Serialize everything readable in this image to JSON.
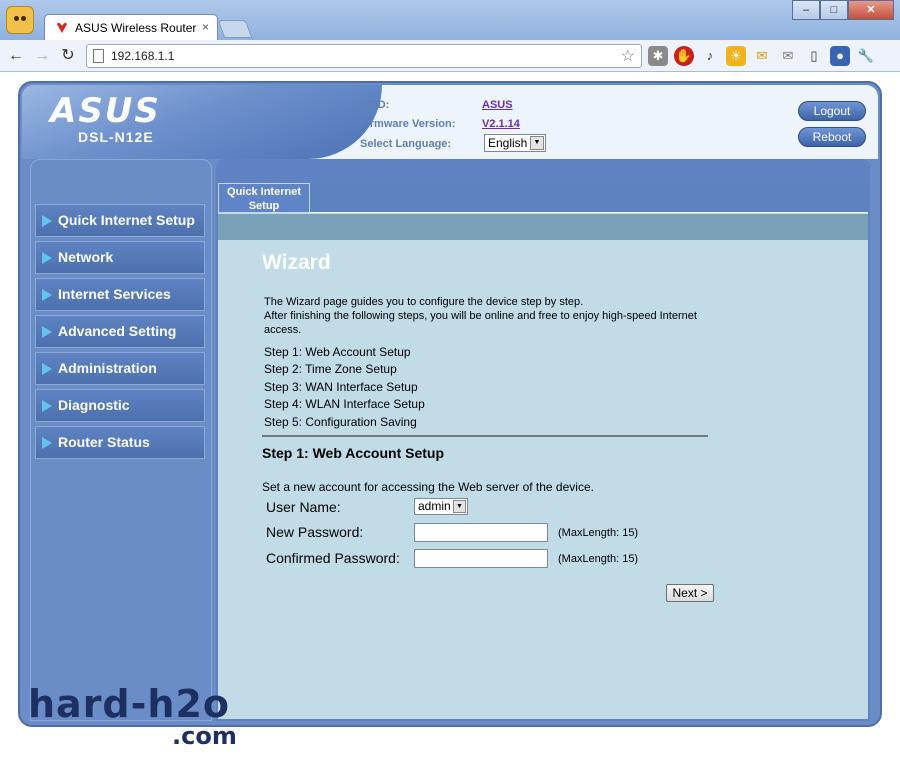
{
  "browser": {
    "tab_title": "ASUS Wireless Router",
    "tab_close": "×",
    "url": "192.168.1.1",
    "window_buttons": {
      "minimize": "–",
      "maximize": "□",
      "close": "✕"
    }
  },
  "router": {
    "brand": "ASUS",
    "model": "DSL-N12E",
    "ssid_label": "SSID:",
    "ssid_value": "ASUS",
    "firmware_label": "Firmware Version:",
    "firmware_value": "V2.1.14",
    "language_label": "Select Language:",
    "language_value": "English",
    "logout_label": "Logout",
    "reboot_label": "Reboot"
  },
  "menu": {
    "items": [
      "Quick Internet Setup",
      "Network",
      "Internet Services",
      "Advanced Setting",
      "Administration",
      "Diagnostic",
      "Router Status"
    ]
  },
  "content": {
    "tab_label": "Quick Internet Setup",
    "title": "Wizard",
    "intro_line1": "The Wizard page guides you to configure the device step by step.",
    "intro_line2": "After finishing the following steps, you will be online and free to enjoy high-speed Internet access.",
    "steps": [
      "Step 1: Web Account Setup",
      "Step 2: Time Zone Setup",
      "Step 3: WAN Interface Setup",
      "Step 4: WLAN Interface Setup",
      "Step 5: Configuration Saving"
    ],
    "step1_title": "Step 1: Web Account Setup",
    "set_account_text": "Set a new account for accessing the Web server of the device.",
    "user_name_label": "User Name:",
    "user_name_value": "admin",
    "new_password_label": "New Password:",
    "confirmed_password_label": "Confirmed Password:",
    "maxlength_hint": "(MaxLength: 15)",
    "next_label": "Next >"
  },
  "watermark": {
    "main": "hard-h2o",
    "sub": ".com"
  },
  "colors": {
    "frame": "#6a8dc7",
    "content_bg": "#c1dce7",
    "menu_arrow": "#63c3ef",
    "link_purple": "#6a2fb0"
  }
}
